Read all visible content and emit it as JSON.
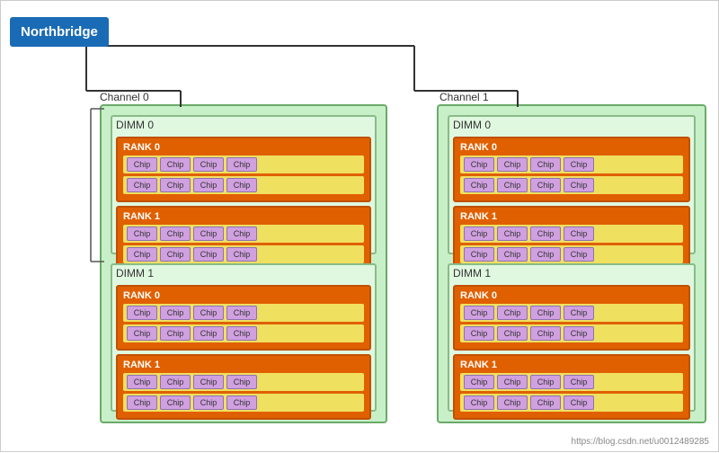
{
  "northbridge": {
    "label": "Northbridge"
  },
  "channels": [
    {
      "label": "Channel 0",
      "id": "channel0",
      "dimms": [
        {
          "label": "DIMM 0",
          "ranks": [
            {
              "label": "RANK 0",
              "rows": [
                [
                  "Chip",
                  "Chip",
                  "Chip",
                  "Chip"
                ],
                [
                  "Chip",
                  "Chip",
                  "Chip",
                  "Chip"
                ]
              ]
            },
            {
              "label": "RANK 1",
              "rows": [
                [
                  "Chip",
                  "Chip",
                  "Chip",
                  "Chip"
                ],
                [
                  "Chip",
                  "Chip",
                  "Chip",
                  "Chip"
                ]
              ]
            }
          ]
        },
        {
          "label": "DIMM 1",
          "ranks": [
            {
              "label": "RANK 0",
              "rows": [
                [
                  "Chip",
                  "Chip",
                  "Chip",
                  "Chip"
                ],
                [
                  "Chip",
                  "Chip",
                  "Chip",
                  "Chip"
                ]
              ]
            },
            {
              "label": "RANK 1",
              "rows": [
                [
                  "Chip",
                  "Chip",
                  "Chip",
                  "Chip"
                ],
                [
                  "Chip",
                  "Chip",
                  "Chip",
                  "Chip"
                ]
              ]
            }
          ]
        }
      ]
    },
    {
      "label": "Channel 1",
      "id": "channel1",
      "dimms": [
        {
          "label": "DIMM 0",
          "ranks": [
            {
              "label": "RANK 0",
              "rows": [
                [
                  "Chip",
                  "Chip",
                  "Chip",
                  "Chip"
                ],
                [
                  "Chip",
                  "Chip",
                  "Chip",
                  "Chip"
                ]
              ]
            },
            {
              "label": "RANK 1",
              "rows": [
                [
                  "Chip",
                  "Chip",
                  "Chip",
                  "Chip"
                ],
                [
                  "Chip",
                  "Chip",
                  "Chip",
                  "Chip"
                ]
              ]
            }
          ]
        },
        {
          "label": "DIMM 1",
          "ranks": [
            {
              "label": "RANK 0",
              "rows": [
                [
                  "Chip",
                  "Chip",
                  "Chip",
                  "Chip"
                ],
                [
                  "Chip",
                  "Chip",
                  "Chip",
                  "Chip"
                ]
              ]
            },
            {
              "label": "RANK 1",
              "rows": [
                [
                  "Chip",
                  "Chip",
                  "Chip",
                  "Chip"
                ],
                [
                  "Chip",
                  "Chip",
                  "Chip",
                  "Chip"
                ]
              ]
            }
          ]
        }
      ]
    }
  ],
  "url": "https://blog.csdn.net/u0012489285"
}
